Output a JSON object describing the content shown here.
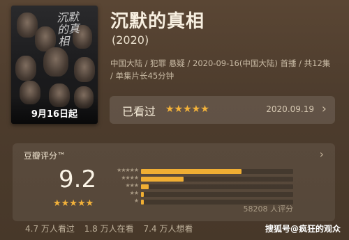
{
  "poster": {
    "title_art": "沉默的真相",
    "date_label": "9月16日起"
  },
  "movie": {
    "title": "沉默的真相",
    "year": "(2020)",
    "meta": "中国大陆 / 犯罪 悬疑 / 2020-09-16(中国大陆) 首播 / 共12集 / 单集片长45分钟"
  },
  "watched": {
    "label": "已看过",
    "stars": "★★★★★",
    "rating_stars": 5,
    "date": "2020.09.19",
    "chevron": "chevron-right-icon"
  },
  "rating": {
    "header": "豆瓣评分™",
    "score": "9.2",
    "score_stars": "★★★★★",
    "count": "58208 人评分",
    "distribution": [
      {
        "stars": "★★★★★",
        "fraction": 0.66
      },
      {
        "stars": "★★★★",
        "fraction": 0.28
      },
      {
        "stars": "★★★",
        "fraction": 0.05
      },
      {
        "stars": "★★",
        "fraction": 0.02
      },
      {
        "stars": "★",
        "fraction": 0.02
      }
    ]
  },
  "stats": {
    "watched": "4.7 万人看过",
    "watching": "1.8 万人在看",
    "want": "7.4 万人想看"
  },
  "watermark": "搜狐号@疯狂的观众",
  "colors": {
    "background": "#4c3b2c",
    "star": "#f4b33a",
    "bar_fill": "#f0ae33"
  }
}
